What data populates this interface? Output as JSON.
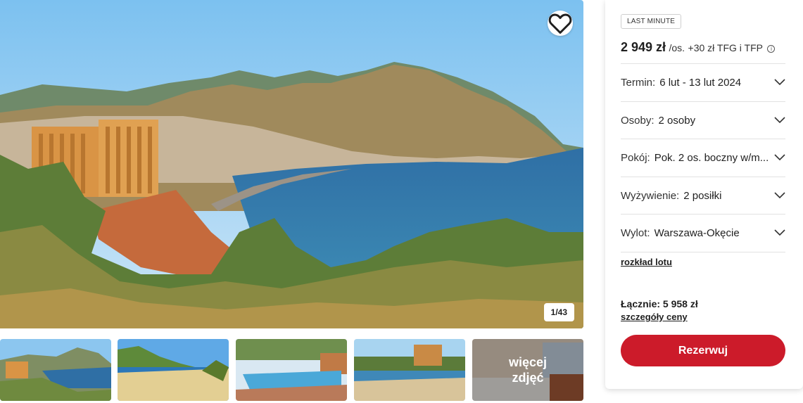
{
  "gallery": {
    "counter": "1/43",
    "more_photos_label": "więcej zdjęć",
    "icons": {
      "favorite": "heart-outline-icon"
    }
  },
  "offer": {
    "badge": "LAST MINUTE",
    "price": "2 949 zł",
    "price_unit": "/os.",
    "price_extra": "+30 zł TFG i TFP",
    "options": [
      {
        "label": "Termin:",
        "value": "6 lut - 13 lut 2024"
      },
      {
        "label": "Osoby:",
        "value": "2 osoby"
      },
      {
        "label": "Pokój:",
        "value": "Pok. 2 os. boczny w/m..."
      },
      {
        "label": "Wyżywienie:",
        "value": "2 posiłki"
      },
      {
        "label": "Wylot:",
        "value": "Warszawa-Okęcie"
      }
    ],
    "flight_schedule_link": "rozkład lotu",
    "total": "Łącznie: 5 958 zł",
    "price_details_link": "szczegóły ceny",
    "reserve_button": "Rezerwuj"
  },
  "colors": {
    "accent": "#cc1b2a",
    "text": "#1f1f1f",
    "divider": "#e2e2e2"
  }
}
